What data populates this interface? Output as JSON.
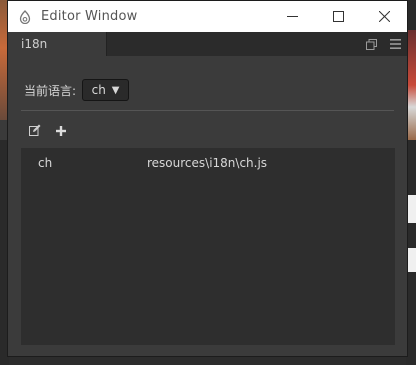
{
  "window": {
    "title": "Editor Window"
  },
  "tabs": [
    {
      "label": "i18n"
    }
  ],
  "language": {
    "label": "当前语言:",
    "selected": "ch"
  },
  "languages": [
    {
      "key": "ch",
      "path": "resources\\i18n\\ch.js"
    }
  ],
  "icons": {
    "app": "app-logo-icon",
    "minimize": "minimize-icon",
    "maximize": "maximize-icon",
    "close": "close-icon",
    "popout": "popout-icon",
    "menu": "menu-icon",
    "edit": "edit-icon",
    "add": "plus-icon"
  }
}
